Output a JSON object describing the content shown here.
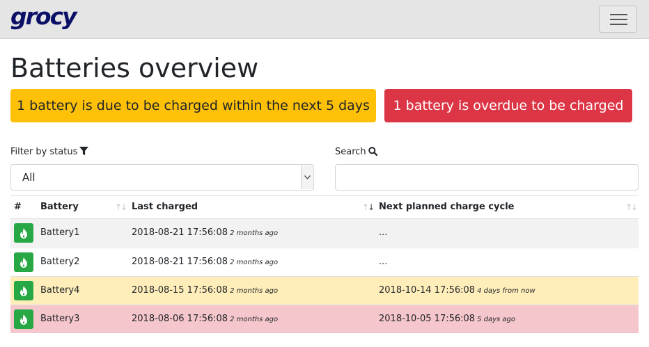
{
  "navbar": {
    "brand": "grocy",
    "menu_toggle_icon": "hamburger-icon"
  },
  "page": {
    "title": "Batteries overview"
  },
  "alerts": {
    "due_soon": "1 battery is due to be charged within the next 5 days",
    "overdue": "1 battery is overdue to be charged"
  },
  "filters": {
    "status_label": "Filter by status",
    "status_icon": "filter-icon",
    "status_value": "All",
    "search_label": "Search",
    "search_icon": "search-icon",
    "search_value": ""
  },
  "table": {
    "headers": {
      "hash": "#",
      "battery": "Battery",
      "last_charged": "Last charged",
      "next_cycle": "Next planned charge cycle"
    },
    "rows": [
      {
        "name": "Battery1",
        "last_charged": "2018-08-21 17:56:08",
        "last_charged_relative": "2 months ago",
        "next_cycle": "...",
        "next_cycle_relative": "",
        "status": "none",
        "row_color": "#f2f2f2"
      },
      {
        "name": "Battery2",
        "last_charged": "2018-08-21 17:56:08",
        "last_charged_relative": "2 months ago",
        "next_cycle": "...",
        "next_cycle_relative": "",
        "status": "none",
        "row_color": "#ffffff"
      },
      {
        "name": "Battery4",
        "last_charged": "2018-08-15 17:56:08",
        "last_charged_relative": "2 months ago",
        "next_cycle": "2018-10-14 17:56:08",
        "next_cycle_relative": "4 days from now",
        "status": "due-soon",
        "row_color": "#ffeeba"
      },
      {
        "name": "Battery3",
        "last_charged": "2018-08-06 17:56:08",
        "last_charged_relative": "2 months ago",
        "next_cycle": "2018-10-05 17:56:08",
        "next_cycle_relative": "5 days ago",
        "status": "overdue",
        "row_color": "#f5c6cb"
      }
    ],
    "charge_button_icon": "fire-icon"
  },
  "colors": {
    "navbar_bg": "#e5e5e5",
    "brand": "#0b1066",
    "warning": "#ffc107",
    "danger": "#dc3545",
    "success": "#28a745"
  }
}
